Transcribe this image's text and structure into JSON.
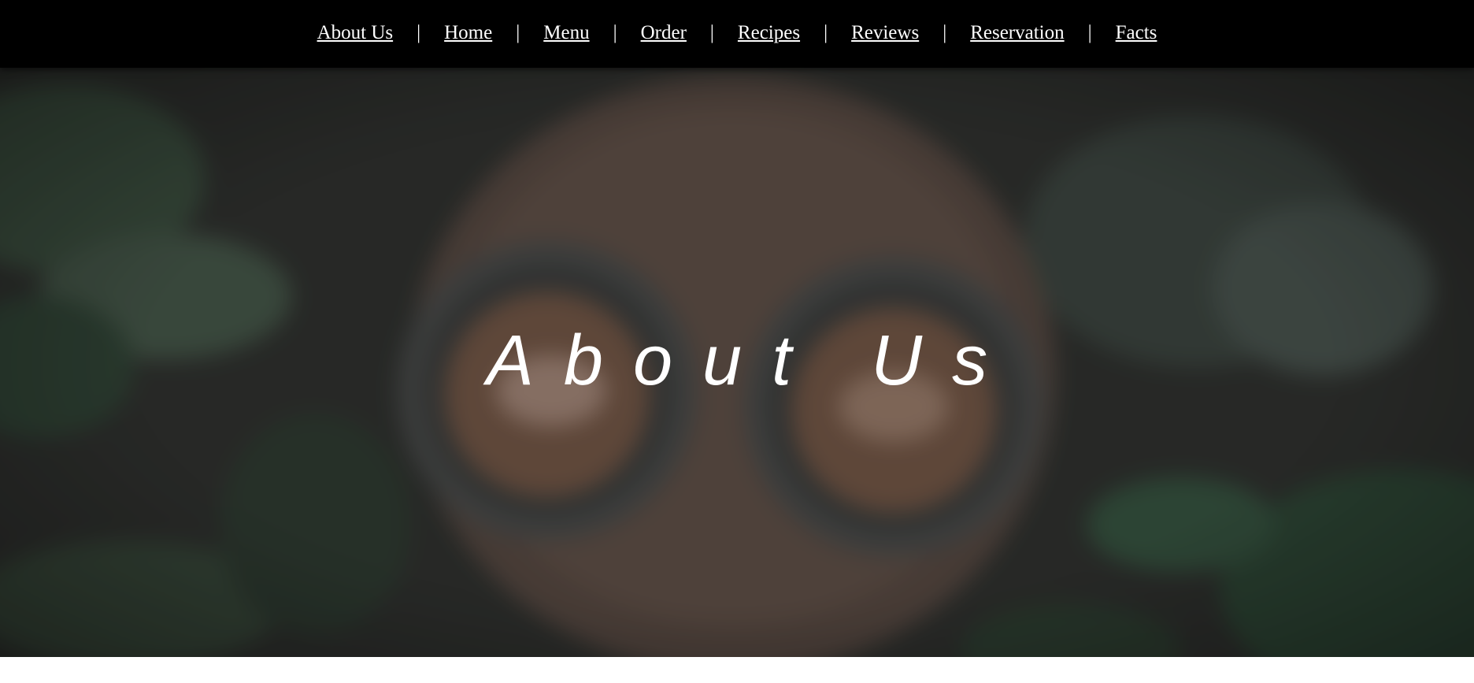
{
  "nav": {
    "items": [
      {
        "label": "About Us"
      },
      {
        "label": "Home"
      },
      {
        "label": "Menu"
      },
      {
        "label": "Order"
      },
      {
        "label": "Recipes"
      },
      {
        "label": "Reviews"
      },
      {
        "label": "Reservation"
      },
      {
        "label": "Facts"
      }
    ],
    "separator": "|"
  },
  "hero": {
    "title": "About Us",
    "background_image": "blurred-coffee-cups-on-wooden-table-with-plants"
  },
  "colors": {
    "navbar_bg": "#000000",
    "nav_text": "#ffffff",
    "hero_text": "#ffffff"
  }
}
